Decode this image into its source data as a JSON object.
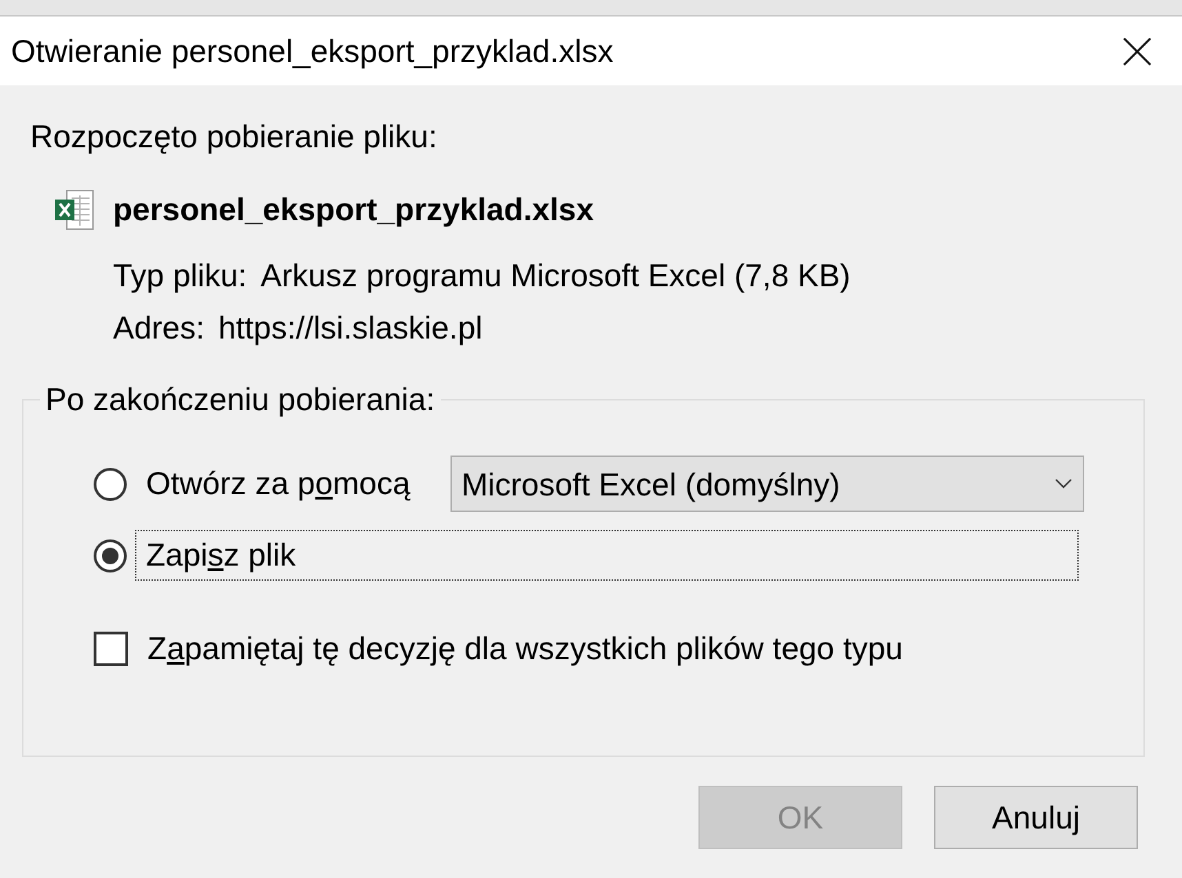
{
  "window": {
    "title": "Otwieranie personel_eksport_przyklad.xlsx"
  },
  "intro": "Rozpoczęto pobieranie pliku:",
  "file": {
    "name": "personel_eksport_przyklad.xlsx",
    "details": [
      {
        "label": "Typ pliku:",
        "value": "Arkusz programu Microsoft Excel (7,8 KB)"
      },
      {
        "label": "Adres:",
        "value": "https://lsi.slaskie.pl"
      }
    ]
  },
  "after_download": {
    "legend": "Po zakończeniu pobierania:",
    "options": [
      {
        "kind": "radio",
        "label_start": "Otwórz za p",
        "access_key": "o",
        "label_end": "mocą",
        "selected": false,
        "focused": false,
        "dropdown": {
          "value": "Microsoft Excel (domyślny)"
        }
      },
      {
        "kind": "radio",
        "label_start": "Zapi",
        "access_key": "s",
        "label_end": "z plik",
        "selected": true,
        "focused": true
      },
      {
        "kind": "checkbox",
        "label_start": "Z",
        "access_key": "a",
        "label_end": "pamiętaj tę decyzję dla wszystkich plików tego typu",
        "checked": false,
        "focused": false
      }
    ]
  },
  "buttons": [
    {
      "label": "OK",
      "disabled": true
    },
    {
      "label": "Anuluj",
      "disabled": false
    }
  ]
}
